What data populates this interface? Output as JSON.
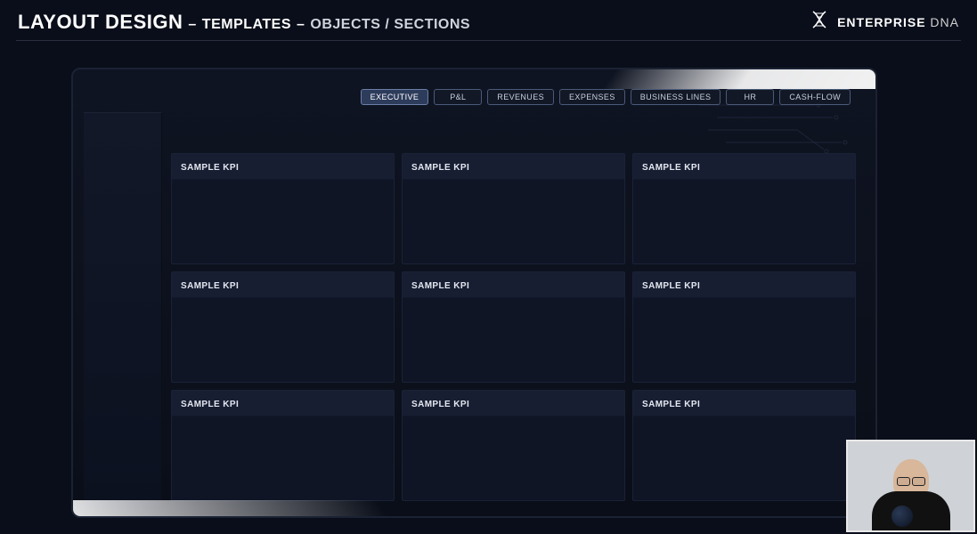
{
  "header": {
    "crumb1": "LAYOUT DESIGN",
    "sep1": "–",
    "crumb2": "TEMPLATES",
    "sep2": "–",
    "crumb3": "OBJECTS / SECTIONS",
    "brand_strong": "ENTERPRISE",
    "brand_thin": " DNA"
  },
  "tabs": [
    {
      "label": "EXECUTIVE",
      "active": true
    },
    {
      "label": "P&L",
      "active": false
    },
    {
      "label": "REVENUES",
      "active": false
    },
    {
      "label": "EXPENSES",
      "active": false
    },
    {
      "label": "BUSINESS LINES",
      "active": false
    },
    {
      "label": "HR",
      "active": false
    },
    {
      "label": "CASH-FLOW",
      "active": false
    }
  ],
  "tiles": [
    {
      "title": "SAMPLE KPI"
    },
    {
      "title": "SAMPLE KPI"
    },
    {
      "title": "SAMPLE KPI"
    },
    {
      "title": "SAMPLE KPI"
    },
    {
      "title": "SAMPLE KPI"
    },
    {
      "title": "SAMPLE KPI"
    },
    {
      "title": "SAMPLE KPI"
    },
    {
      "title": "SAMPLE KPI"
    },
    {
      "title": "SAMPLE KPI"
    }
  ]
}
